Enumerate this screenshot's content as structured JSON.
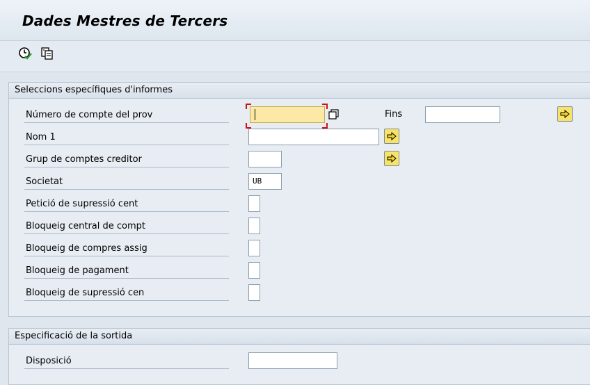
{
  "window": {
    "title": "Dades Mestres de Tercers"
  },
  "toolbar": {
    "execute_icon": "execute-clock-check-icon",
    "variant_icon": "get-variant-icon"
  },
  "selection_panel": {
    "header": "Seleccions específiques d'informes",
    "fields": [
      {
        "label": "Número de compte del prov",
        "value": "",
        "to_label": "Fins",
        "to_value": ""
      },
      {
        "label": "Nom 1",
        "value": ""
      },
      {
        "label": "Grup de comptes creditor",
        "value": ""
      },
      {
        "label": "Societat",
        "value": "UB"
      },
      {
        "label": "Petició de supressió cent",
        "value": ""
      },
      {
        "label": "Bloqueig central de compt",
        "value": ""
      },
      {
        "label": "Bloqueig de compres assig",
        "value": ""
      },
      {
        "label": "Bloqueig de pagament",
        "value": ""
      },
      {
        "label": "Bloqueig de supressió cen",
        "value": ""
      }
    ]
  },
  "output_panel": {
    "header": "Especificació de la sortida",
    "fields": [
      {
        "label": "Disposició",
        "value": ""
      }
    ]
  },
  "colors": {
    "background": "#dfe6ee",
    "focused_field": "#fbe9a5",
    "multiple_selection_button": "#f7e36a"
  }
}
